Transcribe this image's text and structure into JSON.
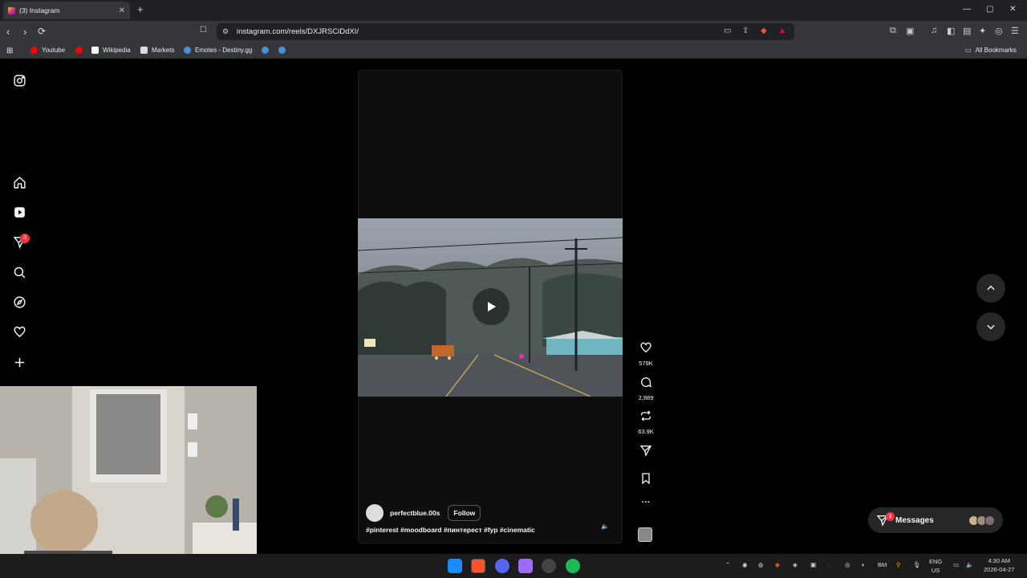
{
  "tab": {
    "title": "(3) Instagram",
    "close": "✕",
    "new_tab": "+"
  },
  "window_controls": {
    "minimize": "—",
    "maximize": "▢",
    "close": "✕"
  },
  "address": {
    "url": "instagram.com/reels/DXJRSCiDdXI/"
  },
  "bookmarks": [
    {
      "label": "Youtube",
      "color": "#ff0000"
    },
    {
      "label": "",
      "color": "#ff0000"
    },
    {
      "label": "Wikipedia",
      "color": "#ffffff"
    },
    {
      "label": "Markets",
      "color": "#ffffff"
    },
    {
      "label": "Emotes - Destiny.gg",
      "color": "#4a90d9"
    },
    {
      "label": "",
      "color": "#4a90d9"
    },
    {
      "label": "",
      "color": "#4a90d9"
    }
  ],
  "all_bookmarks": "All Bookmarks",
  "nav": {
    "items": [
      "instagram-icon",
      "home-icon",
      "reels-icon",
      "direct-icon",
      "search-icon",
      "explore-icon",
      "heart-icon",
      "create-icon"
    ],
    "direct_badge": "3"
  },
  "reel": {
    "username": "perfectblue.00s",
    "follow_label": "Follow",
    "caption": "#pinterest #moodboard #пинтерест #fyp #cinematic",
    "mute_icon": "🔈",
    "likes": "579K",
    "comments": "2,889",
    "reposts": "63.9K",
    "more": "···"
  },
  "messages": {
    "label": "Messages",
    "badge": "3"
  },
  "taskbar": {
    "lang": "ENG",
    "region": "US",
    "time": "4:30 AM",
    "date": "2026-04-27",
    "bm_label": "BM"
  },
  "colors": {
    "accent": "#ff3040",
    "background": "#000000",
    "surface": "#262626"
  }
}
